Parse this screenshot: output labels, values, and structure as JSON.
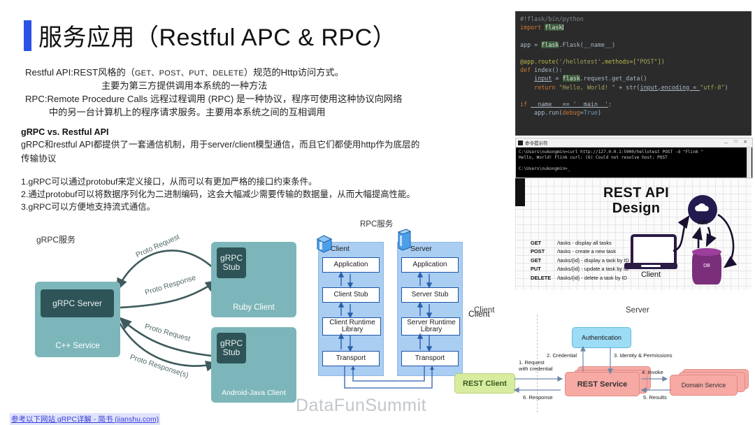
{
  "slide": {
    "title": "服务应用（Restful APC & RPC）",
    "accent_color": "#2a52e8",
    "watermark": "DataFunSummit",
    "reference_link": "参考以下网站 gRPC详解 - 简书 (jianshu.com)"
  },
  "body": {
    "line1": "Restful API:REST风格的（GET、POST、PUT、DELETE）规范的Http访问方式。",
    "line2": "主要为第三方提供调用本系统的一种方法",
    "line3": "RPC:Remote Procedure Calls 远程过程调用 (RPC) 是一种协议，程序可使用这种协议向网络",
    "line4": "中的另一台计算机上的程序请求服务。主要用本系统之间的互相调用",
    "section_heading": "gRPC vs. Restful API",
    "section_line1": "gRPC和restful API都提供了一套通信机制，用于server/client模型通信，而且它们都使用http作为底层的",
    "section_line2": "传输协议",
    "bullets": [
      "1.gRPC可以通过protobuf来定义接口，从而可以有更加严格的接口约束条件。",
      "2.通过protobuf可以将数据序列化为二进制编码，这会大幅减少需要传输的数据量，从而大幅提高性能。",
      "3.gRPC可以方便地支持流式通信。"
    ]
  },
  "grpc_diagram": {
    "label": "gRPC服务",
    "server_box": {
      "inner": "gRPC Server",
      "caption": "C++ Service"
    },
    "clients": [
      {
        "inner": "gRPC\nStub",
        "caption": "Ruby Client"
      },
      {
        "inner": "gRPC\nStub",
        "caption": "Android-Java Client"
      }
    ],
    "arrow_labels": [
      "Proto Request",
      "Proto Response",
      "Proto Request",
      "Proto Response(s)"
    ]
  },
  "rpc_diagram": {
    "label": "RPC服务",
    "client_column": {
      "name": "Client",
      "cells": [
        "Application",
        "Client Stub",
        "Client Runtime Library",
        "Transport"
      ]
    },
    "server_column": {
      "name": "Server",
      "cells": [
        "Application",
        "Server Stub",
        "Server Runtime Library",
        "Transport"
      ]
    },
    "side_label": "Client"
  },
  "code_editor": {
    "lines": [
      "#!flask/bin/python",
      "import flask",
      "",
      "app = flask.Flask(__name__)",
      "",
      "@app.route('/hellotest',methods=[\"POST\"])",
      "def index():",
      "    input = flask.request.get_data()",
      "    return \"Hello, World! \" + str(input,encoding = \"utf-8\")",
      "",
      "if __name__ == '__main__':",
      "    app.run(debug=True)"
    ]
  },
  "terminal": {
    "title": "命令提示符",
    "controls": [
      "－",
      "□",
      "✕"
    ],
    "lines": [
      "C:\\Users\\nukongmin>curl http://127.0.0.1:5000/hellotest POST -d \"Flink \"",
      "Hello, World! Flink curl: (6) Could not resolve host: POST",
      "",
      "C:\\Users\\nukongmin>_"
    ]
  },
  "rest_api_design": {
    "title_line1": "REST API",
    "title_line2": "Design",
    "routes": [
      {
        "verb": "GET",
        "path": "/tasks - display all tasks"
      },
      {
        "verb": "POST",
        "path": "/tasks -  create a new task"
      },
      {
        "verb": "GET",
        "path": "/tasks/{id} - display a task by ID"
      },
      {
        "verb": "PUT",
        "path": "/tasks/{id} - update a task by ID"
      },
      {
        "verb": "DELETE",
        "path": "/tasks/{id} - delete a task by ID"
      }
    ],
    "client_caption": "Client",
    "api_caption": "API",
    "db_caption": "DB"
  },
  "rest_flow": {
    "client_label": "Client",
    "server_label": "Server",
    "nodes": {
      "rest_client": "REST Client",
      "authentication": "Authentication",
      "rest_service": "REST Service",
      "domain_service": "Domain Service"
    },
    "steps": [
      "1.  Request",
      "with credential",
      "2. Credential",
      "3. Identity & Permissions",
      "4. Invoke",
      "5. Results",
      "6. Response"
    ]
  }
}
